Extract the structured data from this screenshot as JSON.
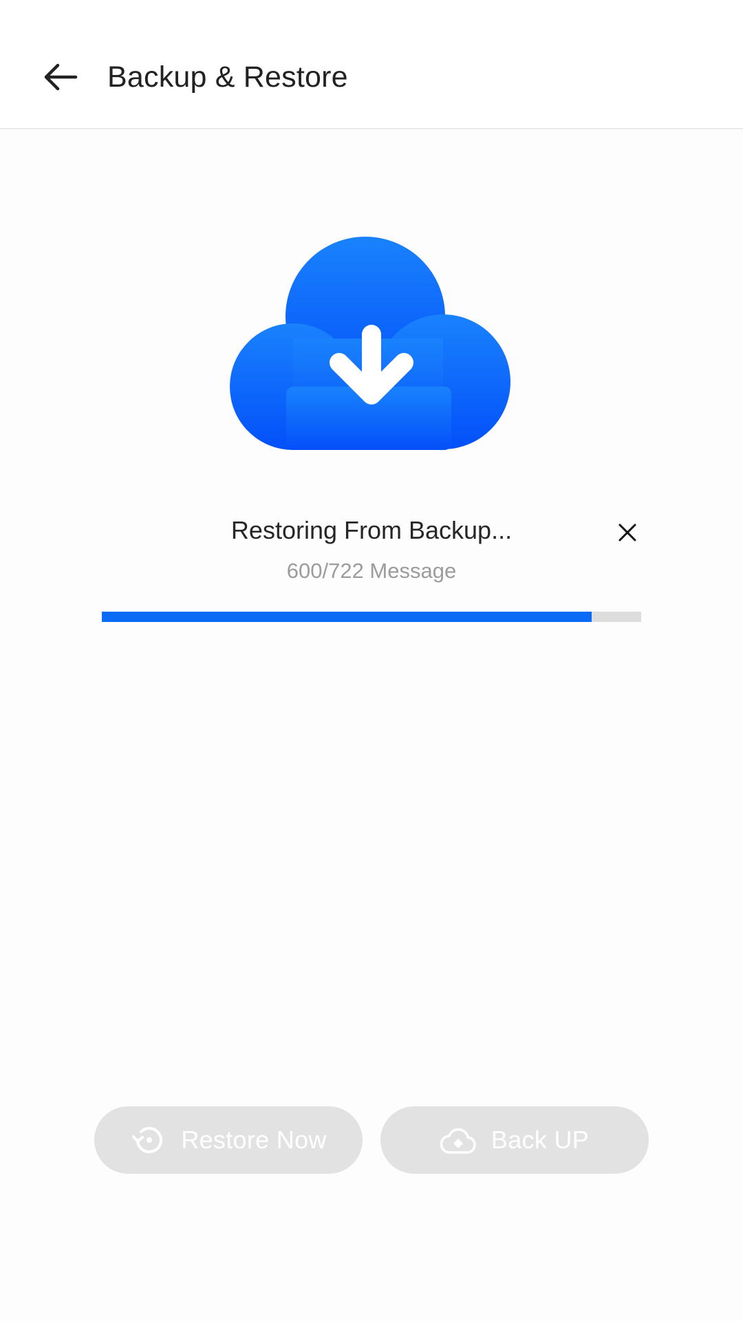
{
  "header": {
    "title": "Backup & Restore",
    "back_icon": "arrow-left-icon"
  },
  "hero": {
    "icon": "cloud-download-icon",
    "gradient_top": "#1a82fc",
    "gradient_bottom": "#0350fa"
  },
  "status": {
    "title": "Restoring From Backup...",
    "progress_text": "600/722 Message",
    "cancel_icon": "close-icon",
    "progress_fraction": 0.908,
    "progress_color": "#0a6cf5",
    "track_color": "#dddddd"
  },
  "actions": {
    "restore_label": "Restore Now",
    "restore_icon": "restore-icon",
    "backup_label": "Back UP",
    "backup_icon": "cloud-upload-icon",
    "button_bg": "#e2e2e2"
  }
}
